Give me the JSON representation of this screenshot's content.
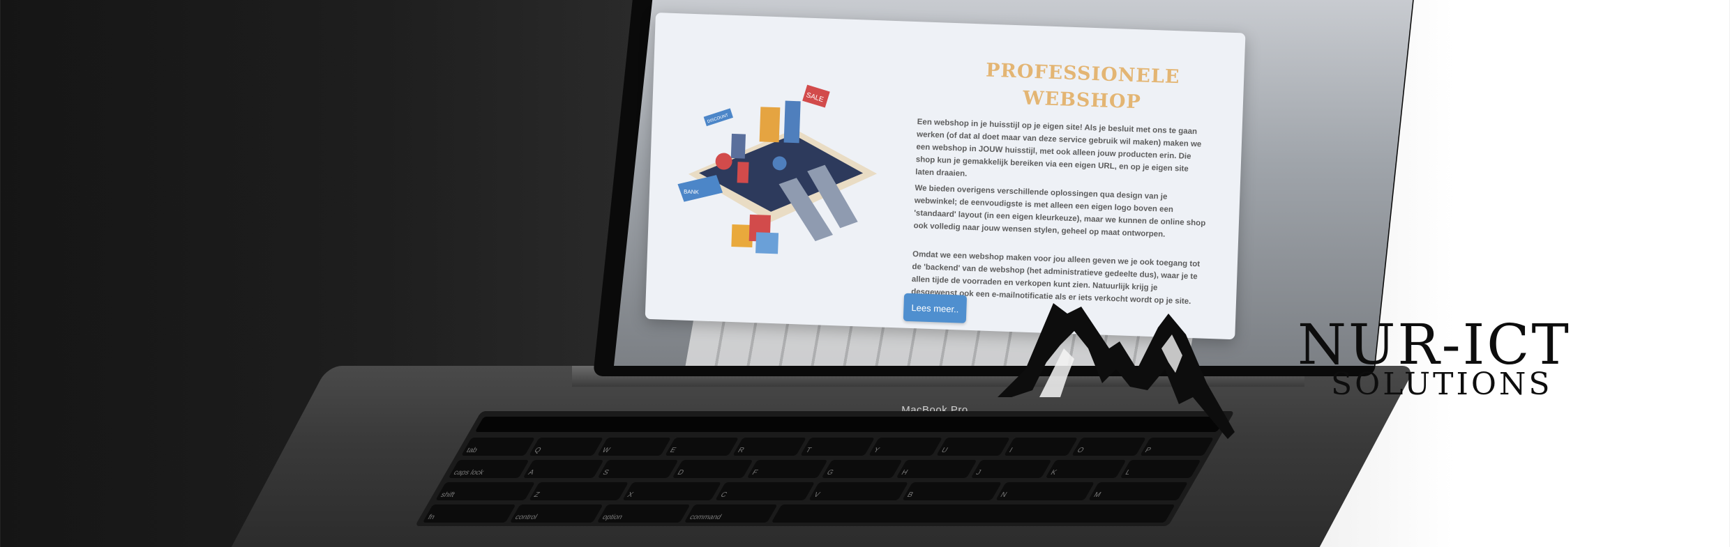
{
  "laptop": {
    "brand_label": "MacBook Pro",
    "keyboard": {
      "row1": [
        "tab",
        "Q",
        "W",
        "E",
        "R",
        "T",
        "Y",
        "U",
        "I",
        "O",
        "P"
      ],
      "row2": [
        "caps lock",
        "A",
        "S",
        "D",
        "F",
        "G",
        "H",
        "J",
        "K",
        "L"
      ],
      "row3": [
        "shift",
        "Z",
        "X",
        "C",
        "V",
        "B",
        "N",
        "M"
      ],
      "row4": [
        "fn",
        "control",
        "option",
        "command"
      ]
    }
  },
  "card": {
    "title": "PROFESSIONELE\nWEBSHOP",
    "paragraphs": [
      "Een webshop in je huisstijl op je eigen site! Als je besluit met ons te gaan werken (of dat al doet maar van deze service gebruik wil maken) maken we een webshop in JOUW huisstijl, met ook alleen jouw producten erin. Die shop kun je gemakkelijk bereiken via een eigen URL, en op je eigen site laten draaien.",
      "We bieden overigens verschillende oplossingen qua design van je webwinkel; de eenvoudigste is met alleen een eigen logo boven een 'standaard' layout (in een eigen kleurkeuze), maar we kunnen de online shop ook volledig naar jouw wensen stylen, geheel op maat ontworpen.",
      "Omdat we een webshop maken voor jou alleen geven we je ook toegang tot de 'backend' van de webshop (het administratieve gedeelte dus), waar je te allen tijde de voorraden en verkopen kunt zien. Natuurlijk krijg je desgewenst ook een e-mailnotificatie als er iets verkocht wordt op je site."
    ],
    "button_label": "Lees meer..",
    "accent_color": "#e3b573",
    "button_color": "#4f8fcf",
    "illustration": {
      "sale_label": "SALE",
      "card_label": "BANK",
      "tag_label": "DISCOUNT"
    }
  },
  "logo": {
    "title": "NUR-ICT",
    "subtitle": "SOLUTIONS",
    "icon": "mountain-icon"
  }
}
